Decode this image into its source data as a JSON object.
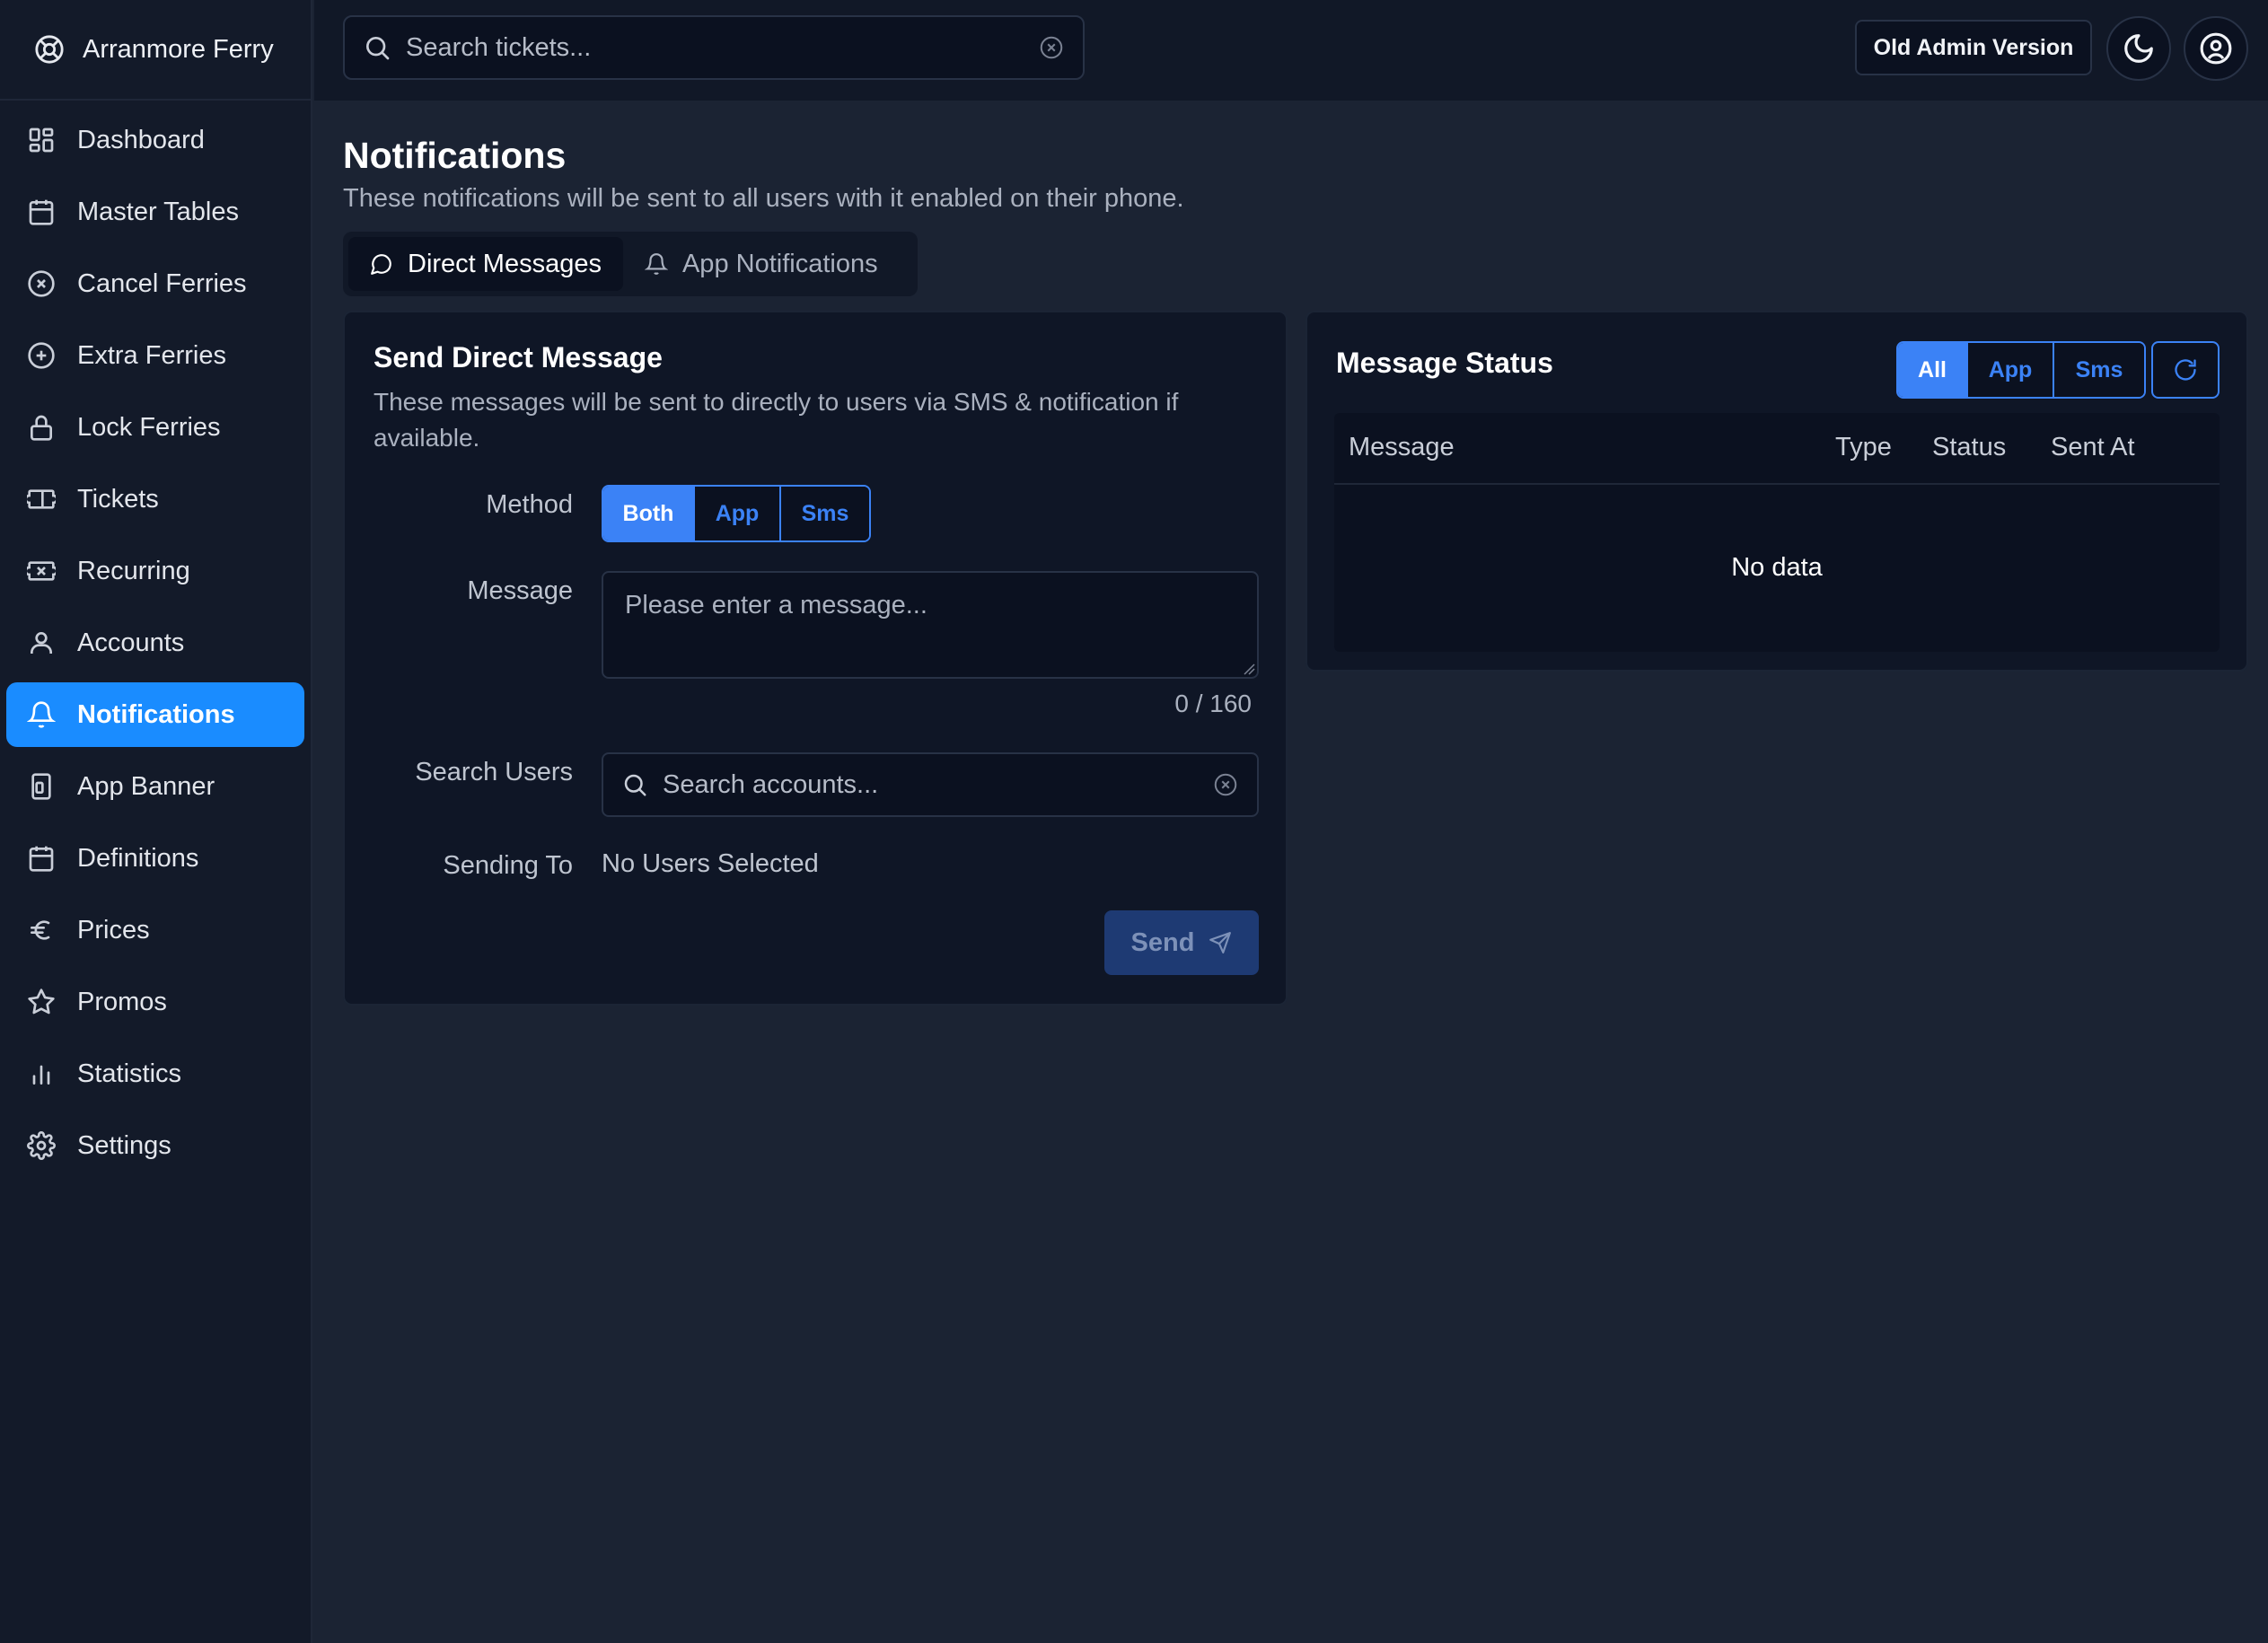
{
  "app": {
    "name": "Arranmore Ferry"
  },
  "sidebar": {
    "items": [
      {
        "label": "Dashboard",
        "icon": "dashboard-icon"
      },
      {
        "label": "Master Tables",
        "icon": "calendar-icon"
      },
      {
        "label": "Cancel Ferries",
        "icon": "circle-x-icon"
      },
      {
        "label": "Extra Ferries",
        "icon": "circle-plus-icon"
      },
      {
        "label": "Lock Ferries",
        "icon": "lock-icon"
      },
      {
        "label": "Tickets",
        "icon": "ticket-icon"
      },
      {
        "label": "Recurring",
        "icon": "ticket-recurring-icon"
      },
      {
        "label": "Accounts",
        "icon": "user-icon"
      },
      {
        "label": "Notifications",
        "icon": "bell-icon",
        "active": true
      },
      {
        "label": "App Banner",
        "icon": "phone-banner-icon"
      },
      {
        "label": "Definitions",
        "icon": "calendar-icon"
      },
      {
        "label": "Prices",
        "icon": "euro-icon"
      },
      {
        "label": "Promos",
        "icon": "star-icon"
      },
      {
        "label": "Statistics",
        "icon": "bar-chart-icon"
      },
      {
        "label": "Settings",
        "icon": "gear-icon"
      }
    ]
  },
  "topbar": {
    "search_placeholder": "Search tickets...",
    "old_admin_label": "Old Admin Version"
  },
  "page": {
    "title": "Notifications",
    "subtitle": "These notifications will be sent to all users with it enabled on their phone.",
    "tabs": [
      {
        "label": "Direct Messages",
        "icon": "chat-icon",
        "active": true
      },
      {
        "label": "App Notifications",
        "icon": "bell-icon",
        "active": false
      }
    ]
  },
  "send_card": {
    "title": "Send Direct Message",
    "description": "These messages will be sent to directly to users via SMS & notification if available.",
    "method_label": "Method",
    "method_options": [
      "Both",
      "App",
      "Sms"
    ],
    "method_selected": "Both",
    "message_label": "Message",
    "message_placeholder": "Please enter a message...",
    "counter": "0 / 160",
    "search_users_label": "Search Users",
    "search_users_placeholder": "Search accounts...",
    "sending_to_label": "Sending To",
    "sending_to_value": "No Users Selected",
    "send_label": "Send"
  },
  "status_card": {
    "title": "Message Status",
    "filter_options": [
      "All",
      "App",
      "Sms"
    ],
    "filter_selected": "All",
    "columns": [
      "Message",
      "Type",
      "Status",
      "Sent At"
    ],
    "empty_text": "No data"
  },
  "colors": {
    "accent": "#3b82f6",
    "nav_active": "#1a8cff",
    "background": "#1b2333",
    "panel": "#0f1626"
  }
}
